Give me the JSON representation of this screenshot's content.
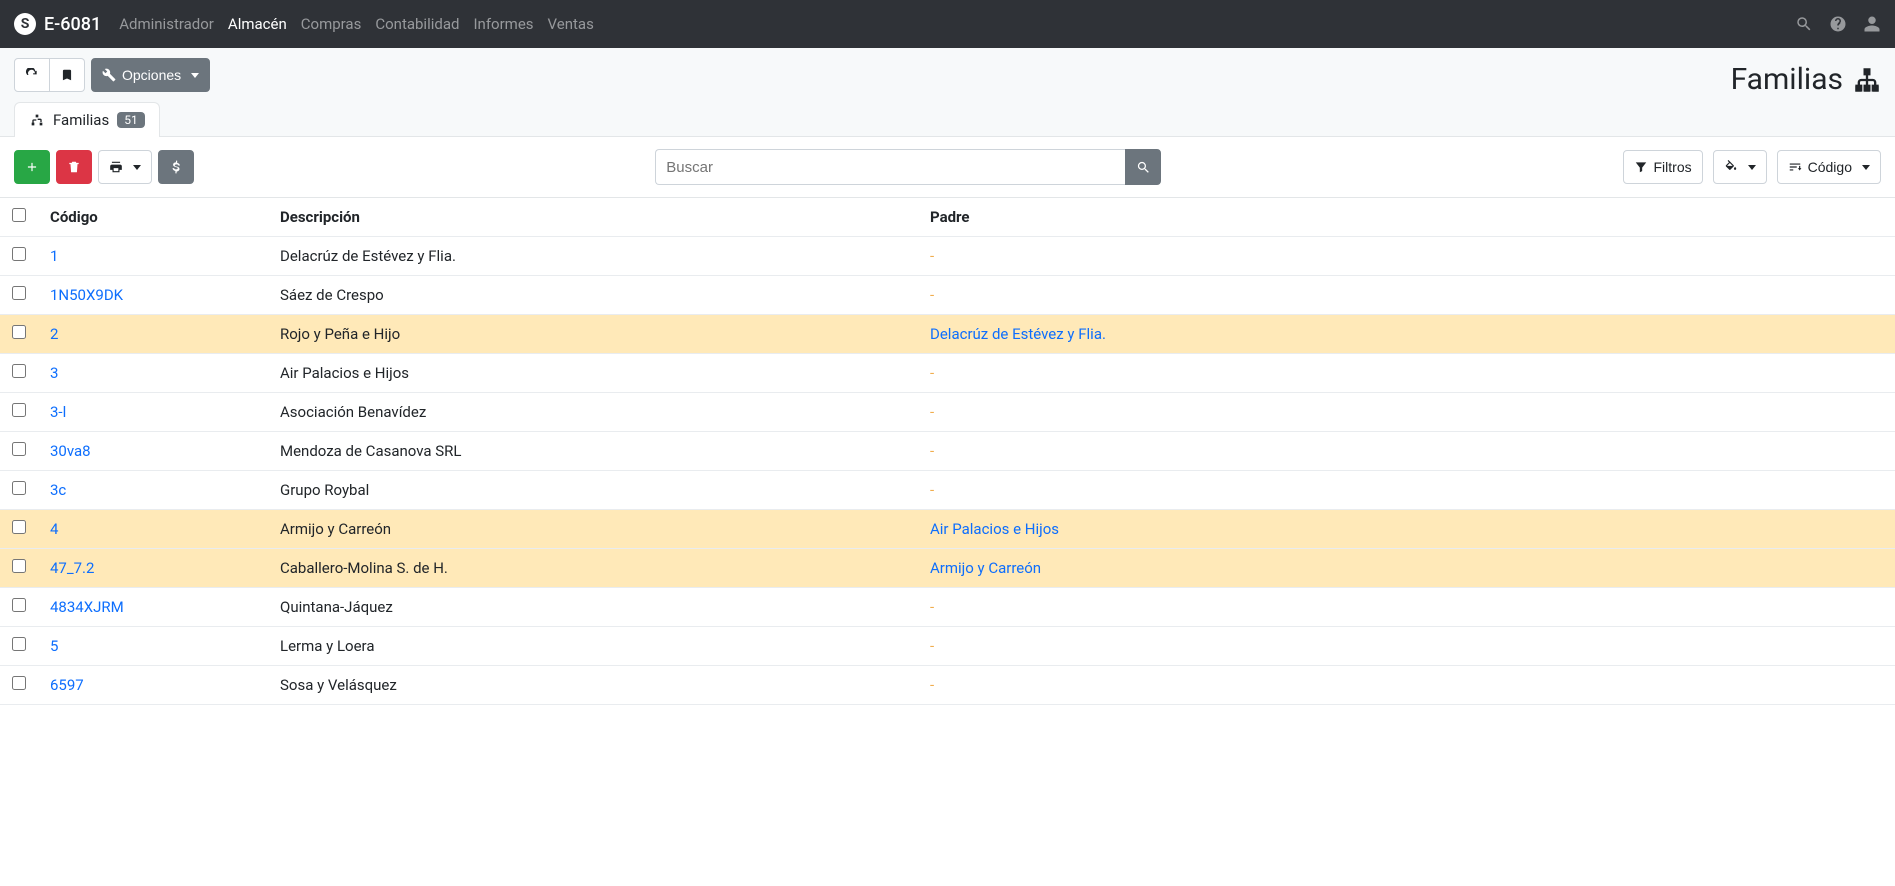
{
  "brand": "E-6081",
  "nav": [
    {
      "label": "Administrador",
      "active": false
    },
    {
      "label": "Almacén",
      "active": true
    },
    {
      "label": "Compras",
      "active": false
    },
    {
      "label": "Contabilidad",
      "active": false
    },
    {
      "label": "Informes",
      "active": false
    },
    {
      "label": "Ventas",
      "active": false
    }
  ],
  "options_label": "Opciones",
  "page_title": "Familias",
  "tab": {
    "label": "Familias",
    "count": "51"
  },
  "search": {
    "placeholder": "Buscar"
  },
  "filters_label": "Filtros",
  "sort_label": "Código",
  "columns": {
    "code": "Código",
    "desc": "Descripción",
    "parent": "Padre"
  },
  "rows": [
    {
      "code": "1",
      "desc": "Delacrúz de Estévez y Flia.",
      "parent": "",
      "highlight": false
    },
    {
      "code": "1N50X9DK",
      "desc": "Sáez de Crespo",
      "parent": "",
      "highlight": false
    },
    {
      "code": "2",
      "desc": "Rojo y Peña e Hijo",
      "parent": "Delacrúz de Estévez y Flia.",
      "highlight": true
    },
    {
      "code": "3",
      "desc": "Air Palacios e Hijos",
      "parent": "",
      "highlight": false
    },
    {
      "code": "3-l",
      "desc": "Asociación Benavídez",
      "parent": "",
      "highlight": false
    },
    {
      "code": "30va8",
      "desc": "Mendoza de Casanova SRL",
      "parent": "",
      "highlight": false
    },
    {
      "code": "3c",
      "desc": "Grupo Roybal",
      "parent": "",
      "highlight": false
    },
    {
      "code": "4",
      "desc": "Armijo y Carreón",
      "parent": "Air Palacios e Hijos",
      "highlight": true
    },
    {
      "code": "47_7.2",
      "desc": "Caballero-Molina S. de H.",
      "parent": "Armijo y Carreón",
      "highlight": true
    },
    {
      "code": "4834XJRM",
      "desc": "Quintana-Jáquez",
      "parent": "",
      "highlight": false
    },
    {
      "code": "5",
      "desc": "Lerma y Loera",
      "parent": "",
      "highlight": false
    },
    {
      "code": "6597",
      "desc": "Sosa y Velásquez",
      "parent": "",
      "highlight": false
    }
  ]
}
